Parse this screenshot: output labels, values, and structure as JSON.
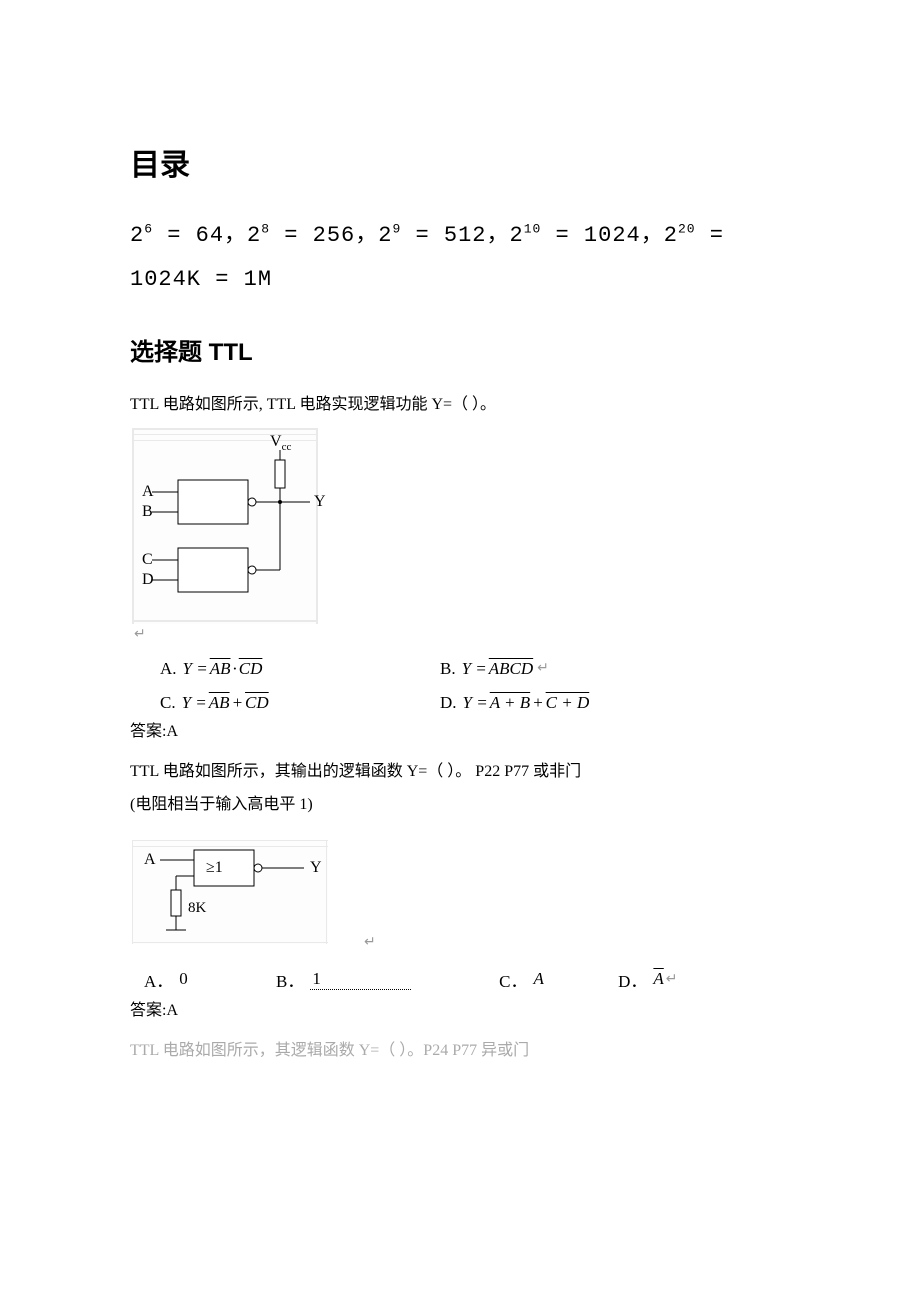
{
  "headings": {
    "h1": "目录",
    "h2": "选择题 TTL"
  },
  "formula_line_html": "2<sup>6</sup> = 64，2<sup>8</sup> = 256，2<sup>9</sup> = 512，2<sup>10</sup> = 1024，2<sup>20</sup> = 1024K = 1M",
  "q1": {
    "prompt": "TTL 电路如图所示, TTL 电路实现逻辑功能 Y=（ ）。",
    "circuit": {
      "vcc_label": "V",
      "vcc_sub": "cc",
      "inputs": [
        "A",
        "B",
        "C",
        "D"
      ],
      "output": "Y"
    },
    "options": {
      "A": {
        "label": "A.",
        "prefix": "Y = ",
        "parts": [
          {
            "t": "AB",
            "over": true
          },
          {
            "t": " · "
          },
          {
            "t": "CD",
            "over": true
          }
        ]
      },
      "B": {
        "label": "B.",
        "prefix": "Y = ",
        "parts": [
          {
            "t": "ABCD",
            "over": true
          }
        ]
      },
      "C": {
        "label": "C.",
        "prefix": "Y = ",
        "parts": [
          {
            "t": "AB",
            "over": true
          },
          {
            "t": " + "
          },
          {
            "t": "CD",
            "over": true
          }
        ]
      },
      "D": {
        "label": "D.",
        "prefix": "Y = ",
        "parts": [
          {
            "t": "A + B",
            "over": true
          },
          {
            "t": " + "
          },
          {
            "t": "C + D",
            "over": true
          }
        ]
      }
    },
    "answer": "答案:A"
  },
  "q2": {
    "prompt": "TTL 电路如图所示，其输出的逻辑函数 Y=（  ）。 P22   P77   或非门",
    "note": "(电阻相当于输入高电平 1)",
    "circuit": {
      "gate_label": "≥1",
      "input": "A",
      "output": "Y",
      "resistor": "8K"
    },
    "options": {
      "A": {
        "label": "A．",
        "text": "0"
      },
      "B": {
        "label": "B．",
        "text": "1",
        "dotted": true
      },
      "C": {
        "label": "C．",
        "text": "A",
        "italic": true
      },
      "D": {
        "label": "D．",
        "text": "A",
        "italic": true,
        "over": true
      }
    },
    "answer": "答案:A"
  },
  "q3": {
    "prompt": "TTL 电路如图所示，其逻辑函数 Y=（ ）。P24  P77  异或门"
  },
  "glyphs": {
    "enter": "↵"
  }
}
